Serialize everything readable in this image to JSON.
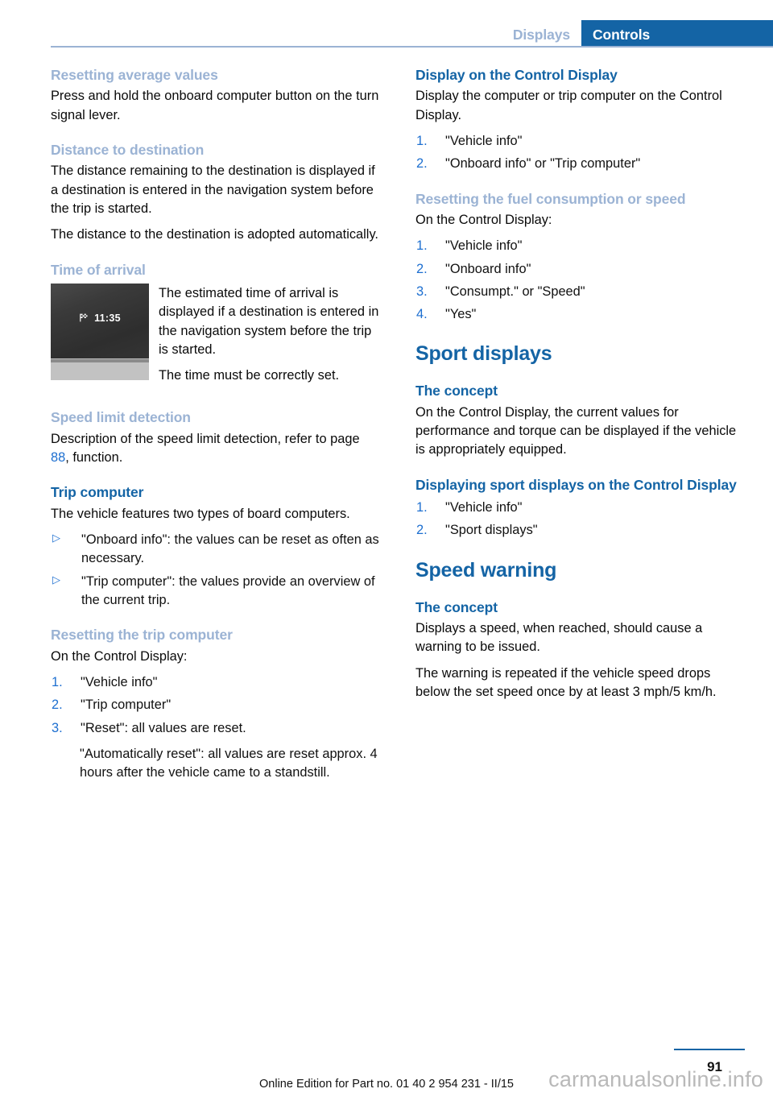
{
  "header": {
    "tab_inactive": "Displays",
    "tab_active": "Controls"
  },
  "left_column": {
    "s1": {
      "heading": "Resetting average values",
      "p1": "Press and hold the onboard computer button on the turn signal lever."
    },
    "s2": {
      "heading": "Distance to destination",
      "p1": "The distance remaining to the destination is displayed if a destination is entered in the navigation system before the trip is started.",
      "p2": "The distance to the destination is adopted automatically."
    },
    "s3": {
      "heading": "Time of arrival",
      "figure": {
        "icon": "checkered-flag-icon",
        "time": "11:35"
      },
      "p1": "The estimated time of arrival is displayed if a destination is entered in the navigation system before the trip is started.",
      "p2": "The time must be correctly set."
    },
    "s4": {
      "heading": "Speed limit detection",
      "p1_before": "Description of the speed limit detection, refer to page ",
      "p1_ref": "88",
      "p1_after": ", function."
    },
    "s5": {
      "heading": "Trip computer",
      "p1": "The vehicle features two types of board computers.",
      "bullets": [
        {
          "marker": "▷",
          "text": "\"Onboard info\": the values can be reset as often as necessary."
        },
        {
          "marker": "▷",
          "text": "\"Trip computer\": the values provide an overview of the current trip."
        }
      ]
    },
    "s6": {
      "heading": "Resetting the trip computer",
      "p1": "On the Control Display:",
      "steps": [
        {
          "marker": "1.",
          "text": "\"Vehicle info\""
        },
        {
          "marker": "2.",
          "text": "\"Trip computer\""
        },
        {
          "marker": "3.",
          "text": "\"Reset\": all values are reset."
        }
      ],
      "step_extra": "\"Automatically reset\": all values are reset approx. 4 hours after the vehicle came to a standstill."
    }
  },
  "right_column": {
    "s1": {
      "heading": "Display on the Control Display",
      "p1": "Display the computer or trip computer on the Control Display.",
      "steps": [
        {
          "marker": "1.",
          "text": "\"Vehicle info\""
        },
        {
          "marker": "2.",
          "text": "\"Onboard info\" or \"Trip computer\""
        }
      ]
    },
    "s2": {
      "heading": "Resetting the fuel consumption or speed",
      "p1": "On the Control Display:",
      "steps": [
        {
          "marker": "1.",
          "text": "\"Vehicle info\""
        },
        {
          "marker": "2.",
          "text": "\"Onboard info\""
        },
        {
          "marker": "3.",
          "text": "\"Consumpt.\" or \"Speed\""
        },
        {
          "marker": "4.",
          "text": "\"Yes\""
        }
      ]
    },
    "s3": {
      "heading": "Sport displays",
      "sub1": {
        "heading": "The concept",
        "p1": "On the Control Display, the current values for performance and torque can be displayed if the vehicle is appropriately equipped."
      },
      "sub2": {
        "heading": "Displaying sport displays on the Control Display",
        "steps": [
          {
            "marker": "1.",
            "text": "\"Vehicle info\""
          },
          {
            "marker": "2.",
            "text": "\"Sport displays\""
          }
        ]
      }
    },
    "s4": {
      "heading": "Speed warning",
      "sub1": {
        "heading": "The concept",
        "p1": "Displays a speed, when reached, should cause a warning to be issued.",
        "p2": "The warning is repeated if the vehicle speed drops below the set speed once by at least 3 mph/5 km/h."
      }
    }
  },
  "footer": {
    "page_number": "91",
    "edition_line": "Online Edition for Part no. 01 40 2 954 231 - II/15",
    "watermark": "carmanualsonline.info"
  },
  "colors": {
    "accent_blue": "#1464a5",
    "light_blue": "#9bb3d4",
    "link_blue": "#1d6fd0"
  }
}
